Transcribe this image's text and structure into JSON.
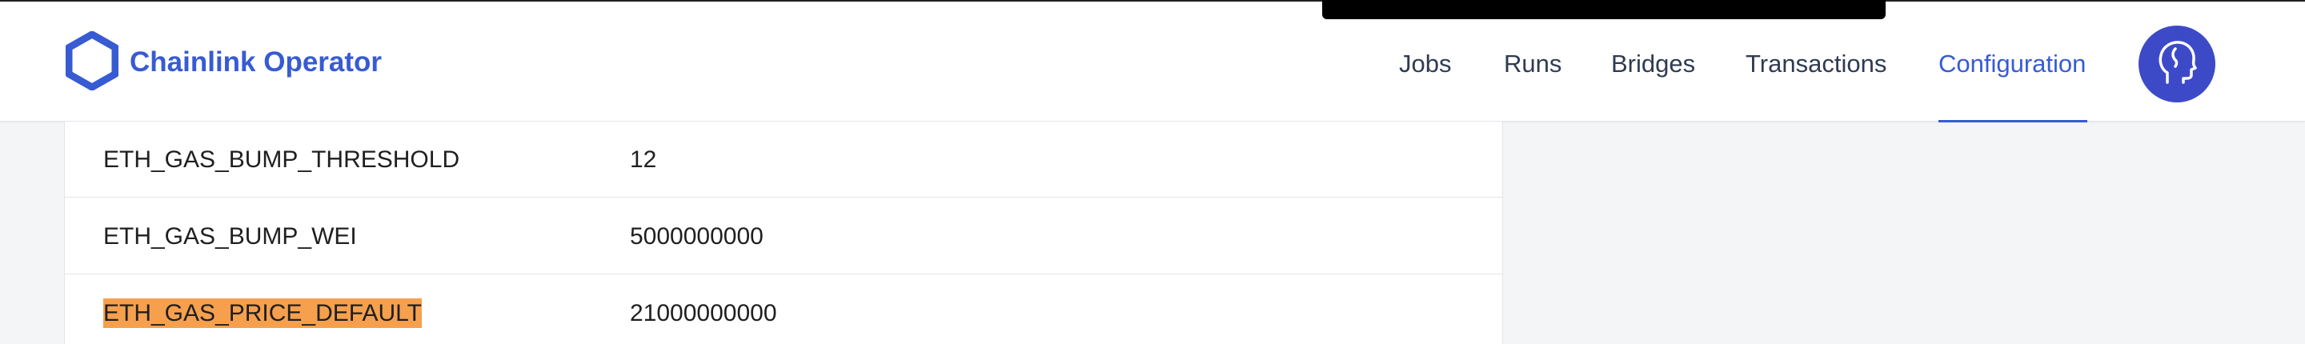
{
  "brand": {
    "name": "Chainlink Operator",
    "logo_icon": "chainlink-hexagon-icon",
    "color": "#375bd2"
  },
  "nav": {
    "items": [
      {
        "label": "Jobs",
        "active": false
      },
      {
        "label": "Runs",
        "active": false
      },
      {
        "label": "Bridges",
        "active": false
      },
      {
        "label": "Transactions",
        "active": false
      },
      {
        "label": "Configuration",
        "active": true
      }
    ],
    "active_color": "#375bd2"
  },
  "avatar": {
    "icon": "user-head-icon",
    "color": "#3d4ac8"
  },
  "config_table": {
    "rows": [
      {
        "key": "ETH_GAS_BUMP_THRESHOLD",
        "value": "12",
        "highlighted": false
      },
      {
        "key": "ETH_GAS_BUMP_WEI",
        "value": "5000000000",
        "highlighted": false
      },
      {
        "key": "ETH_GAS_PRICE_DEFAULT",
        "value": "21000000000",
        "highlighted": true
      }
    ],
    "highlight_color": "#f6a04d"
  }
}
